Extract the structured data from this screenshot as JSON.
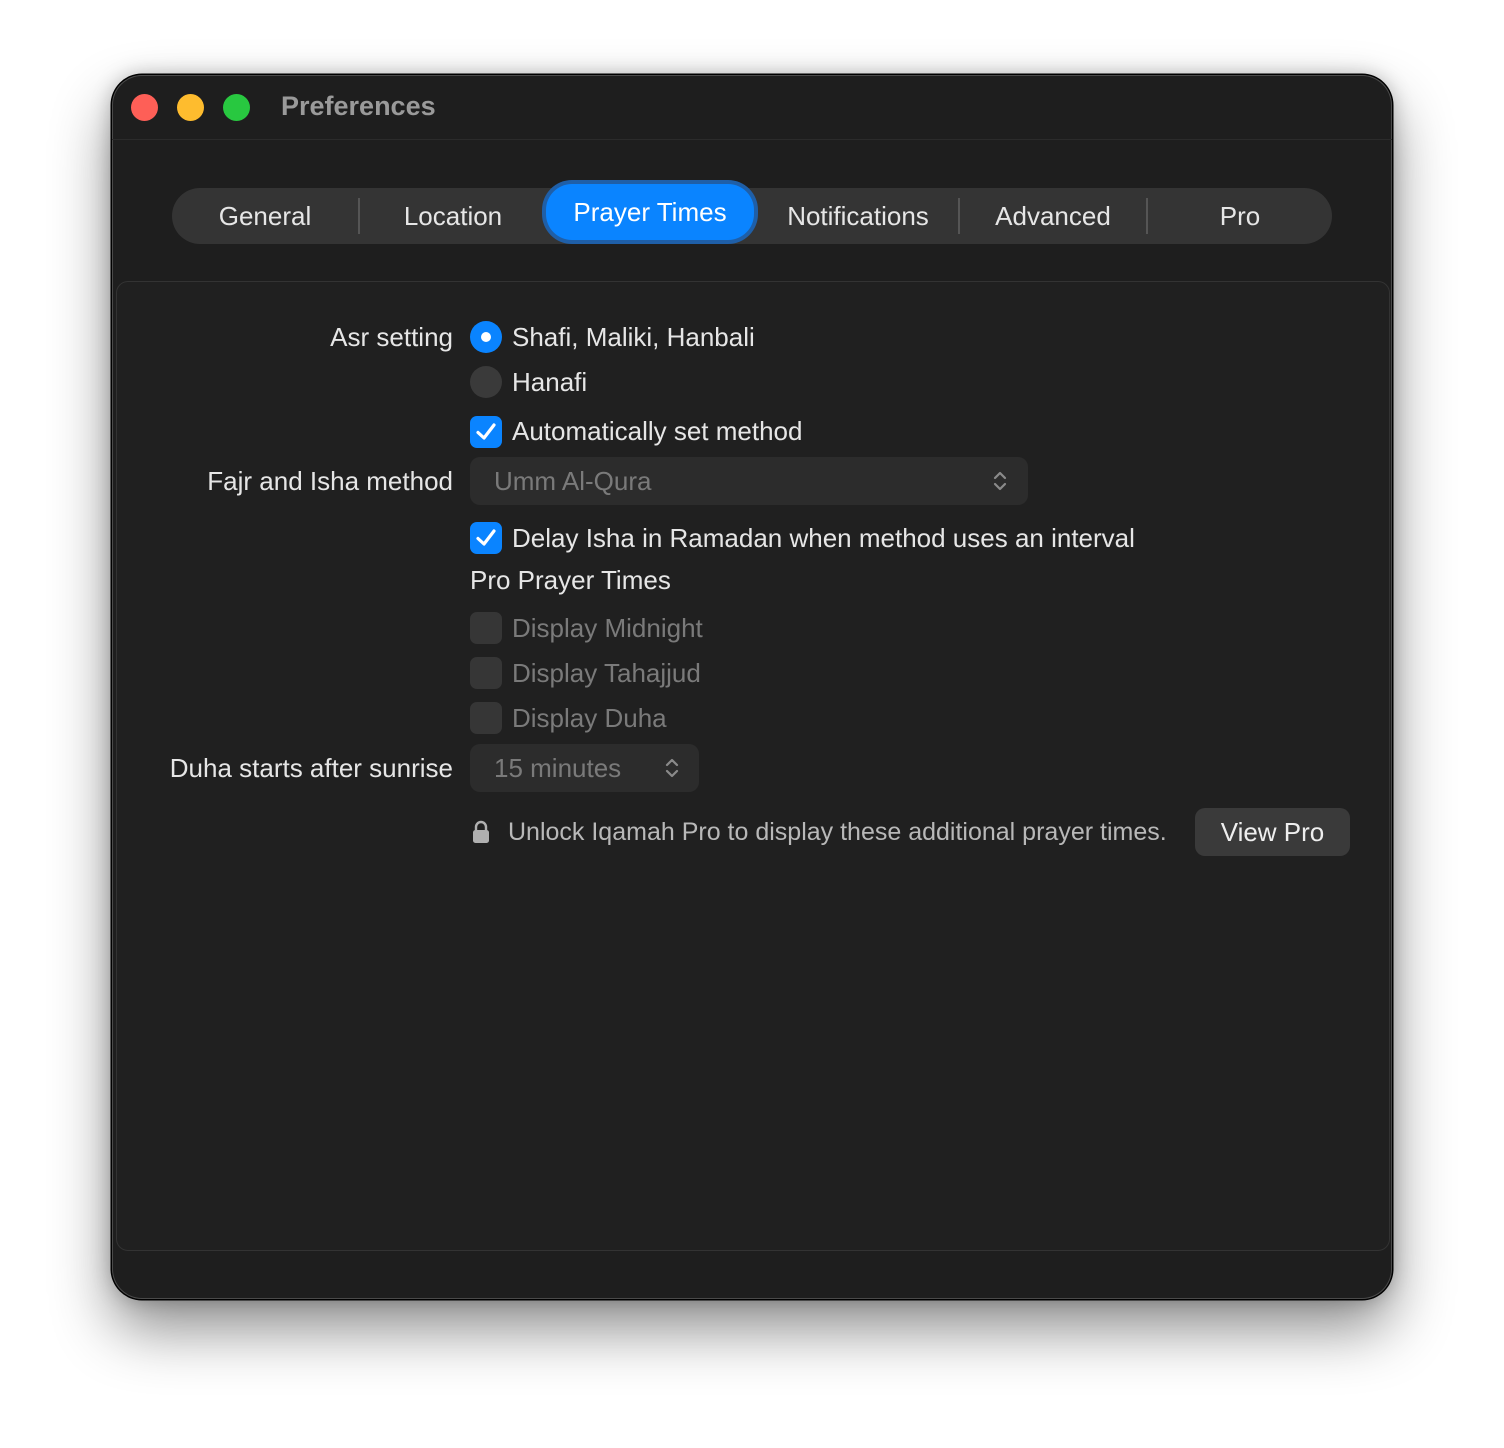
{
  "window": {
    "title": "Preferences",
    "controls": [
      "close-button",
      "minimize-button",
      "zoom-button"
    ]
  },
  "tabs": [
    {
      "label": "General"
    },
    {
      "label": "Location"
    },
    {
      "label": "Prayer Times",
      "active": true
    },
    {
      "label": "Notifications"
    },
    {
      "label": "Advanced"
    },
    {
      "label": "Pro"
    }
  ],
  "asr": {
    "label": "Asr setting",
    "options": [
      {
        "label": "Shafi, Maliki, Hanbali",
        "selected": true
      },
      {
        "label": "Hanafi",
        "selected": false
      }
    ]
  },
  "auto_method": {
    "label": "Automatically set method",
    "checked": true
  },
  "fajr_isha": {
    "label": "Fajr and Isha method",
    "value": "Umm Al-Qura"
  },
  "delay_isha": {
    "label": "Delay Isha in Ramadan when method uses an interval",
    "checked": true
  },
  "pro_section": {
    "title": "Pro Prayer Times",
    "options": [
      {
        "label": "Display Midnight",
        "checked": false
      },
      {
        "label": "Display Tahajjud",
        "checked": false
      },
      {
        "label": "Display Duha",
        "checked": false
      }
    ]
  },
  "duha": {
    "label": "Duha starts after sunrise",
    "value": "15 minutes"
  },
  "unlock": {
    "message": "Unlock Iqamah Pro to display these additional prayer times.",
    "button_label": "View Pro"
  },
  "colors": {
    "accent": "#0a84ff",
    "window_bg": "#1e1e1e",
    "panel_bg": "#202020"
  }
}
